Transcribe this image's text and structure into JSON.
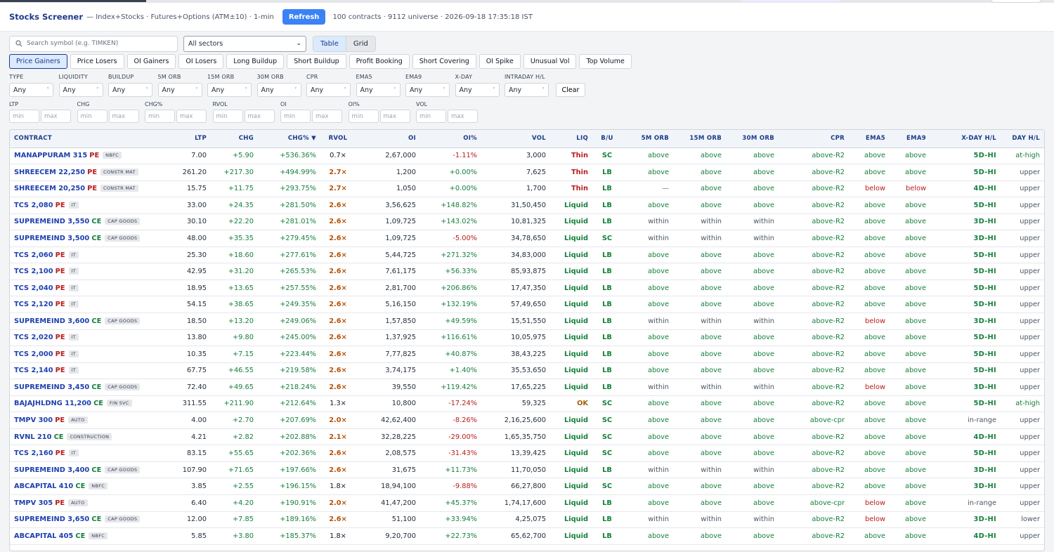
{
  "header": {
    "title": "Stocks Screener",
    "subtitle": "— Index+Stocks · Futures+Options (ATM±10) · 1-min",
    "refresh_label": "Refresh",
    "stats": "100 contracts · 9112 universe · 2026-09-18 17:35:18 IST"
  },
  "toolbar": {
    "search_placeholder": "Search symbol (e.g. TIMKEN)",
    "sector_value": "All sectors",
    "view_table": "Table",
    "view_grid": "Grid"
  },
  "presets": [
    "Price Gainers",
    "Price Losers",
    "OI Gainers",
    "OI Losers",
    "Long Buildup",
    "Short Buildup",
    "Profit Booking",
    "Short Covering",
    "OI Spike",
    "Unusual Vol",
    "Top Volume"
  ],
  "active_preset": "Price Gainers",
  "filters": [
    {
      "label": "TYPE",
      "value": "Any"
    },
    {
      "label": "LIQUIDITY",
      "value": "Any"
    },
    {
      "label": "BUILDUP",
      "value": "Any"
    },
    {
      "label": "5M ORB",
      "value": "Any"
    },
    {
      "label": "15M ORB",
      "value": "Any"
    },
    {
      "label": "30M ORB",
      "value": "Any"
    },
    {
      "label": "CPR",
      "value": "Any"
    },
    {
      "label": "EMA5",
      "value": "Any"
    },
    {
      "label": "EMA9",
      "value": "Any"
    },
    {
      "label": "X-DAY",
      "value": "Any"
    },
    {
      "label": "INTRADAY H/L",
      "value": "Any"
    }
  ],
  "clear_label": "Clear",
  "ranges": [
    {
      "label": "LTP",
      "min": "min",
      "max": "max"
    },
    {
      "label": "CHG",
      "min": "min",
      "max": "max"
    },
    {
      "label": "CHG%",
      "min": "min",
      "max": "max"
    },
    {
      "label": "RVOL",
      "min": "min",
      "max": "max"
    },
    {
      "label": "OI",
      "min": "min",
      "max": "max"
    },
    {
      "label": "OI%",
      "min": "min",
      "max": "max"
    },
    {
      "label": "VOL",
      "min": "min",
      "max": "max"
    }
  ],
  "columns": [
    "CONTRACT",
    "LTP",
    "CHG",
    "CHG% ▼",
    "RVOL",
    "OI",
    "OI%",
    "VOL",
    "LIQ",
    "B/U",
    "5M ORB",
    "15M ORB",
    "30M ORB",
    "CPR",
    "EMA5",
    "EMA9",
    "X-DAY H/L",
    "DAY H/L"
  ],
  "rows": [
    {
      "sym": "MANAPPURAM 315",
      "type": "PE",
      "tag": "NBFC",
      "ltp": "7.00",
      "chg": "+5.90",
      "chgp": "+536.36%",
      "rvol": "0.7×",
      "oi": "2,67,000",
      "oip": "-1.11%",
      "vol": "3,000",
      "liq": "Thin",
      "bu": "SC",
      "o5": "above",
      "o15": "above",
      "o30": "above",
      "cpr": "above-R2",
      "ema5": "above",
      "ema9": "above",
      "xday": "5D-HI",
      "dayhl": "at-high"
    },
    {
      "sym": "SHREECEM 22,250",
      "type": "PE",
      "tag": "CONSTR MAT",
      "ltp": "261.20",
      "chg": "+217.30",
      "chgp": "+494.99%",
      "rvol": "2.7×",
      "oi": "1,200",
      "oip": "+0.00%",
      "vol": "7,625",
      "liq": "Thin",
      "bu": "LB",
      "o5": "above",
      "o15": "above",
      "o30": "above",
      "cpr": "above-R2",
      "ema5": "above",
      "ema9": "above",
      "xday": "5D-HI",
      "dayhl": "upper"
    },
    {
      "sym": "SHREECEM 20,250",
      "type": "PE",
      "tag": "CONSTR MAT",
      "ltp": "15.75",
      "chg": "+11.75",
      "chgp": "+293.75%",
      "rvol": "2.7×",
      "oi": "1,050",
      "oip": "+0.00%",
      "vol": "1,700",
      "liq": "Thin",
      "bu": "LB",
      "o5": "—",
      "o15": "above",
      "o30": "above",
      "cpr": "above-R2",
      "ema5": "below",
      "ema9": "below",
      "xday": "4D-HI",
      "dayhl": "upper"
    },
    {
      "sym": "TCS 2,080",
      "type": "PE",
      "tag": "IT",
      "ltp": "33.00",
      "chg": "+24.35",
      "chgp": "+281.50%",
      "rvol": "2.6×",
      "oi": "3,56,625",
      "oip": "+148.82%",
      "vol": "31,50,450",
      "liq": "Liquid",
      "bu": "LB",
      "o5": "above",
      "o15": "above",
      "o30": "above",
      "cpr": "above-R2",
      "ema5": "above",
      "ema9": "above",
      "xday": "5D-HI",
      "dayhl": "upper"
    },
    {
      "sym": "SUPREMEIND 3,550",
      "type": "CE",
      "tag": "CAP GOODS",
      "ltp": "30.10",
      "chg": "+22.20",
      "chgp": "+281.01%",
      "rvol": "2.6×",
      "oi": "1,09,725",
      "oip": "+143.02%",
      "vol": "10,81,325",
      "liq": "Liquid",
      "bu": "LB",
      "o5": "within",
      "o15": "within",
      "o30": "within",
      "cpr": "above-R2",
      "ema5": "above",
      "ema9": "above",
      "xday": "3D-HI",
      "dayhl": "upper"
    },
    {
      "sym": "SUPREMEIND 3,500",
      "type": "CE",
      "tag": "CAP GOODS",
      "ltp": "48.00",
      "chg": "+35.35",
      "chgp": "+279.45%",
      "rvol": "2.6×",
      "oi": "1,09,725",
      "oip": "-5.00%",
      "vol": "34,78,650",
      "liq": "Liquid",
      "bu": "SC",
      "o5": "within",
      "o15": "within",
      "o30": "within",
      "cpr": "above-R2",
      "ema5": "above",
      "ema9": "above",
      "xday": "3D-HI",
      "dayhl": "upper"
    },
    {
      "sym": "TCS 2,060",
      "type": "PE",
      "tag": "IT",
      "ltp": "25.30",
      "chg": "+18.60",
      "chgp": "+277.61%",
      "rvol": "2.6×",
      "oi": "5,44,725",
      "oip": "+271.32%",
      "vol": "34,83,000",
      "liq": "Liquid",
      "bu": "LB",
      "o5": "above",
      "o15": "above",
      "o30": "above",
      "cpr": "above-R2",
      "ema5": "above",
      "ema9": "above",
      "xday": "5D-HI",
      "dayhl": "upper"
    },
    {
      "sym": "TCS 2,100",
      "type": "PE",
      "tag": "IT",
      "ltp": "42.95",
      "chg": "+31.20",
      "chgp": "+265.53%",
      "rvol": "2.6×",
      "oi": "7,61,175",
      "oip": "+56.33%",
      "vol": "85,93,875",
      "liq": "Liquid",
      "bu": "LB",
      "o5": "above",
      "o15": "above",
      "o30": "above",
      "cpr": "above-R2",
      "ema5": "above",
      "ema9": "above",
      "xday": "5D-HI",
      "dayhl": "upper"
    },
    {
      "sym": "TCS 2,040",
      "type": "PE",
      "tag": "IT",
      "ltp": "18.95",
      "chg": "+13.65",
      "chgp": "+257.55%",
      "rvol": "2.6×",
      "oi": "2,81,700",
      "oip": "+206.86%",
      "vol": "17,47,350",
      "liq": "Liquid",
      "bu": "LB",
      "o5": "above",
      "o15": "above",
      "o30": "above",
      "cpr": "above-R2",
      "ema5": "above",
      "ema9": "above",
      "xday": "5D-HI",
      "dayhl": "upper"
    },
    {
      "sym": "TCS 2,120",
      "type": "PE",
      "tag": "IT",
      "ltp": "54.15",
      "chg": "+38.65",
      "chgp": "+249.35%",
      "rvol": "2.6×",
      "oi": "5,16,150",
      "oip": "+132.19%",
      "vol": "57,49,650",
      "liq": "Liquid",
      "bu": "LB",
      "o5": "above",
      "o15": "above",
      "o30": "above",
      "cpr": "above-R2",
      "ema5": "above",
      "ema9": "above",
      "xday": "5D-HI",
      "dayhl": "upper"
    },
    {
      "sym": "SUPREMEIND 3,600",
      "type": "CE",
      "tag": "CAP GOODS",
      "ltp": "18.50",
      "chg": "+13.20",
      "chgp": "+249.06%",
      "rvol": "2.6×",
      "oi": "1,57,850",
      "oip": "+49.59%",
      "vol": "15,51,550",
      "liq": "Liquid",
      "bu": "LB",
      "o5": "within",
      "o15": "within",
      "o30": "within",
      "cpr": "above-R2",
      "ema5": "below",
      "ema9": "above",
      "xday": "3D-HI",
      "dayhl": "upper"
    },
    {
      "sym": "TCS 2,020",
      "type": "PE",
      "tag": "IT",
      "ltp": "13.80",
      "chg": "+9.80",
      "chgp": "+245.00%",
      "rvol": "2.6×",
      "oi": "1,37,925",
      "oip": "+116.61%",
      "vol": "10,05,975",
      "liq": "Liquid",
      "bu": "LB",
      "o5": "above",
      "o15": "above",
      "o30": "above",
      "cpr": "above-R2",
      "ema5": "above",
      "ema9": "above",
      "xday": "5D-HI",
      "dayhl": "upper"
    },
    {
      "sym": "TCS 2,000",
      "type": "PE",
      "tag": "IT",
      "ltp": "10.35",
      "chg": "+7.15",
      "chgp": "+223.44%",
      "rvol": "2.6×",
      "oi": "7,77,825",
      "oip": "+40.87%",
      "vol": "38,43,225",
      "liq": "Liquid",
      "bu": "LB",
      "o5": "above",
      "o15": "above",
      "o30": "above",
      "cpr": "above-R2",
      "ema5": "above",
      "ema9": "above",
      "xday": "5D-HI",
      "dayhl": "upper"
    },
    {
      "sym": "TCS 2,140",
      "type": "PE",
      "tag": "IT",
      "ltp": "67.75",
      "chg": "+46.55",
      "chgp": "+219.58%",
      "rvol": "2.6×",
      "oi": "3,74,175",
      "oip": "+1.40%",
      "vol": "35,53,650",
      "liq": "Liquid",
      "bu": "LB",
      "o5": "above",
      "o15": "above",
      "o30": "above",
      "cpr": "above-R2",
      "ema5": "above",
      "ema9": "above",
      "xday": "5D-HI",
      "dayhl": "upper"
    },
    {
      "sym": "SUPREMEIND 3,450",
      "type": "CE",
      "tag": "CAP GOODS",
      "ltp": "72.40",
      "chg": "+49.65",
      "chgp": "+218.24%",
      "rvol": "2.6×",
      "oi": "39,550",
      "oip": "+119.42%",
      "vol": "17,65,225",
      "liq": "Liquid",
      "bu": "LB",
      "o5": "within",
      "o15": "within",
      "o30": "within",
      "cpr": "above-R2",
      "ema5": "below",
      "ema9": "above",
      "xday": "3D-HI",
      "dayhl": "upper"
    },
    {
      "sym": "BAJAJHLDNG 11,200",
      "type": "CE",
      "tag": "FIN SVC",
      "ltp": "311.55",
      "chg": "+211.90",
      "chgp": "+212.64%",
      "rvol": "1.3×",
      "oi": "10,800",
      "oip": "-17.24%",
      "vol": "59,325",
      "liq": "OK",
      "bu": "SC",
      "o5": "above",
      "o15": "above",
      "o30": "above",
      "cpr": "above-R2",
      "ema5": "above",
      "ema9": "above",
      "xday": "5D-HI",
      "dayhl": "at-high"
    },
    {
      "sym": "TMPV 300",
      "type": "PE",
      "tag": "AUTO",
      "ltp": "4.00",
      "chg": "+2.70",
      "chgp": "+207.69%",
      "rvol": "2.0×",
      "oi": "42,62,400",
      "oip": "-8.26%",
      "vol": "2,16,25,600",
      "liq": "Liquid",
      "bu": "SC",
      "o5": "above",
      "o15": "above",
      "o30": "above",
      "cpr": "above-cpr",
      "ema5": "above",
      "ema9": "above",
      "xday": "in-range",
      "dayhl": "upper"
    },
    {
      "sym": "RVNL 210",
      "type": "CE",
      "tag": "CONSTRUCTION",
      "ltp": "4.21",
      "chg": "+2.82",
      "chgp": "+202.88%",
      "rvol": "2.1×",
      "oi": "32,28,225",
      "oip": "-29.00%",
      "vol": "1,65,35,750",
      "liq": "Liquid",
      "bu": "SC",
      "o5": "above",
      "o15": "above",
      "o30": "above",
      "cpr": "above-R2",
      "ema5": "above",
      "ema9": "above",
      "xday": "4D-HI",
      "dayhl": "upper"
    },
    {
      "sym": "TCS 2,160",
      "type": "PE",
      "tag": "IT",
      "ltp": "83.15",
      "chg": "+55.65",
      "chgp": "+202.36%",
      "rvol": "2.6×",
      "oi": "2,08,575",
      "oip": "-31.43%",
      "vol": "13,39,425",
      "liq": "Liquid",
      "bu": "SC",
      "o5": "above",
      "o15": "above",
      "o30": "above",
      "cpr": "above-R2",
      "ema5": "above",
      "ema9": "above",
      "xday": "5D-HI",
      "dayhl": "upper"
    },
    {
      "sym": "SUPREMEIND 3,400",
      "type": "CE",
      "tag": "CAP GOODS",
      "ltp": "107.90",
      "chg": "+71.65",
      "chgp": "+197.66%",
      "rvol": "2.6×",
      "oi": "31,675",
      "oip": "+11.73%",
      "vol": "11,70,050",
      "liq": "Liquid",
      "bu": "LB",
      "o5": "within",
      "o15": "within",
      "o30": "within",
      "cpr": "above-R2",
      "ema5": "above",
      "ema9": "above",
      "xday": "3D-HI",
      "dayhl": "upper"
    },
    {
      "sym": "ABCAPITAL 410",
      "type": "CE",
      "tag": "NBFC",
      "ltp": "3.85",
      "chg": "+2.55",
      "chgp": "+196.15%",
      "rvol": "1.8×",
      "oi": "18,94,100",
      "oip": "-9.88%",
      "vol": "66,27,800",
      "liq": "Liquid",
      "bu": "SC",
      "o5": "above",
      "o15": "above",
      "o30": "above",
      "cpr": "above-R2",
      "ema5": "above",
      "ema9": "above",
      "xday": "3D-HI",
      "dayhl": "upper"
    },
    {
      "sym": "TMPV 305",
      "type": "PE",
      "tag": "AUTO",
      "ltp": "6.40",
      "chg": "+4.20",
      "chgp": "+190.91%",
      "rvol": "2.0×",
      "oi": "41,47,200",
      "oip": "+45.37%",
      "vol": "1,74,17,600",
      "liq": "Liquid",
      "bu": "LB",
      "o5": "above",
      "o15": "above",
      "o30": "above",
      "cpr": "above-cpr",
      "ema5": "below",
      "ema9": "above",
      "xday": "in-range",
      "dayhl": "upper"
    },
    {
      "sym": "SUPREMEIND 3,650",
      "type": "CE",
      "tag": "CAP GOODS",
      "ltp": "12.00",
      "chg": "+7.85",
      "chgp": "+189.16%",
      "rvol": "2.6×",
      "oi": "51,100",
      "oip": "+33.94%",
      "vol": "4,25,075",
      "liq": "Liquid",
      "bu": "LB",
      "o5": "within",
      "o15": "within",
      "o30": "within",
      "cpr": "above-R2",
      "ema5": "below",
      "ema9": "above",
      "xday": "3D-HI",
      "dayhl": "lower"
    },
    {
      "sym": "ABCAPITAL 405",
      "type": "CE",
      "tag": "NBFC",
      "ltp": "5.85",
      "chg": "+3.80",
      "chgp": "+185.37%",
      "rvol": "1.8×",
      "oi": "9,20,700",
      "oip": "+22.73%",
      "vol": "65,62,700",
      "liq": "Liquid",
      "bu": "LB",
      "o5": "above",
      "o15": "above",
      "o30": "above",
      "cpr": "above-R2",
      "ema5": "above",
      "ema9": "above",
      "xday": "4D-HI",
      "dayhl": "upper"
    }
  ]
}
